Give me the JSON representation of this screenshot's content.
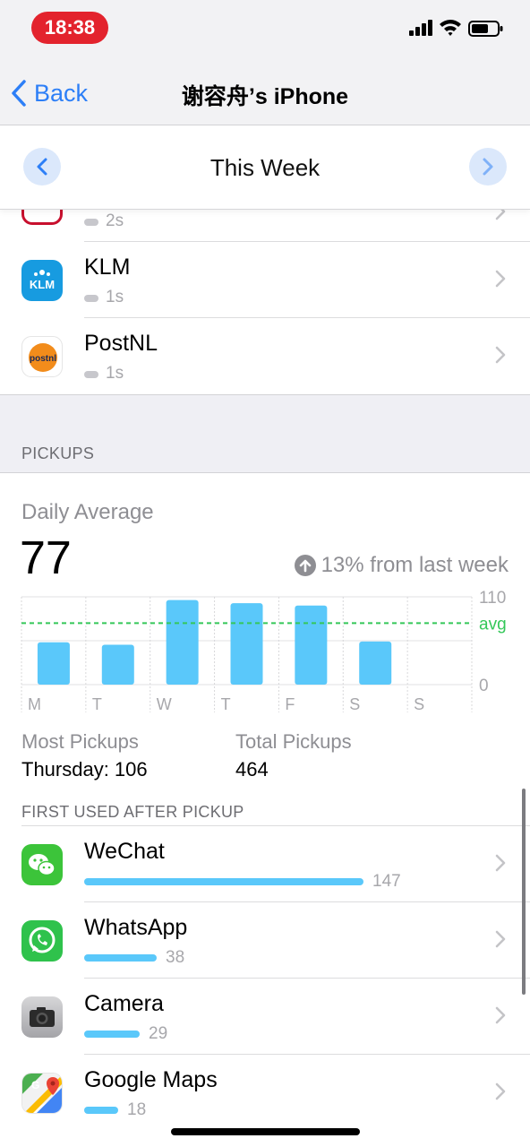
{
  "status_bar": {
    "time": "18:38"
  },
  "nav": {
    "back_label": "Back",
    "title": "谢容舟’s iPhone"
  },
  "week": {
    "title": "This Week"
  },
  "apps_top": [
    {
      "name": "",
      "value": "2s",
      "icon": "partial-app-icon"
    },
    {
      "name": "KLM",
      "value": "1s",
      "icon": "klm-icon"
    },
    {
      "name": "PostNL",
      "value": "1s",
      "icon": "postnl-icon"
    }
  ],
  "pickups": {
    "section_label": "PICKUPS",
    "daily_average_label": "Daily Average",
    "daily_average_value": "77",
    "change_text": "13% from last week",
    "most_label": "Most Pickups",
    "most_value": "Thursday: 106",
    "total_label": "Total Pickups",
    "total_value": "464"
  },
  "chart_data": {
    "type": "bar",
    "categories": [
      "M",
      "T",
      "W",
      "T",
      "F",
      "S",
      "S"
    ],
    "values": [
      53,
      50,
      106,
      102,
      99,
      54,
      0
    ],
    "average": 77,
    "average_label": "avg",
    "ylim": [
      0,
      110
    ],
    "y_ticks": [
      "110",
      "0"
    ],
    "colors": {
      "bar": "#5ac8fa",
      "avg_line": "#34c759"
    }
  },
  "first_used": {
    "section_label": "FIRST USED AFTER PICKUP",
    "items": [
      {
        "name": "WeChat",
        "value": "147",
        "count": 147,
        "icon": "wechat-icon"
      },
      {
        "name": "WhatsApp",
        "value": "38",
        "count": 38,
        "icon": "whatsapp-icon"
      },
      {
        "name": "Camera",
        "value": "29",
        "count": 29,
        "icon": "camera-icon"
      },
      {
        "name": "Google Maps",
        "value": "18",
        "count": 18,
        "icon": "google-maps-icon"
      }
    ]
  },
  "colors": {
    "accent": "#2d7ff7",
    "bar": "#5ac8fa",
    "pill": "#e3232d"
  }
}
